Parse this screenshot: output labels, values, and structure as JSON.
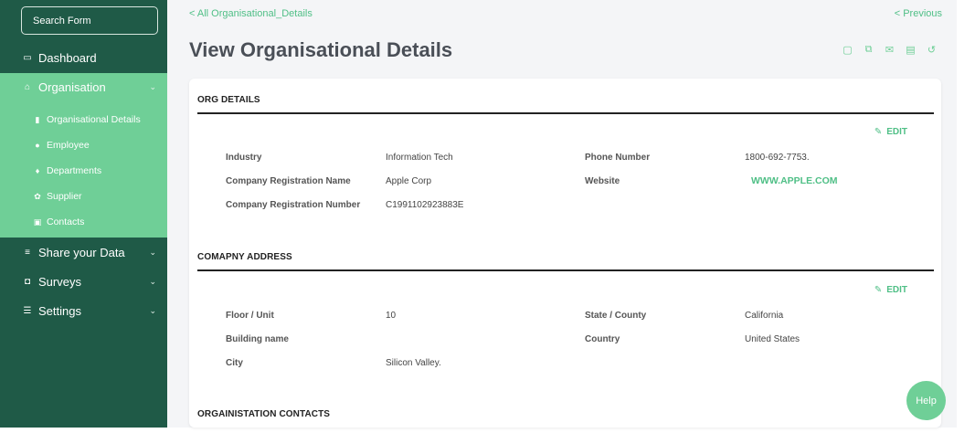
{
  "sidebar": {
    "search_label": "Search Form",
    "items": [
      {
        "label": "Dashboard",
        "icon": "dashboard-icon"
      },
      {
        "label": "Organisation",
        "icon": "bank-icon"
      },
      {
        "label": "Share your Data",
        "icon": "database-icon"
      },
      {
        "label": "Surveys",
        "icon": "survey-icon"
      },
      {
        "label": "Settings",
        "icon": "sliders-icon"
      }
    ],
    "sub_items": [
      {
        "label": "Organisational Details",
        "icon": "document-icon"
      },
      {
        "label": "Employee",
        "icon": "person-icon"
      },
      {
        "label": "Departments",
        "icon": "person-icon"
      },
      {
        "label": "Supplier",
        "icon": "supplier-icon"
      },
      {
        "label": "Contacts",
        "icon": "contacts-icon"
      }
    ]
  },
  "header": {
    "breadcrumb": "< All Organisational_Details",
    "previous": "< Previous",
    "title": "View Organisational Details"
  },
  "org_details": {
    "title": "ORG DETAILS",
    "edit": "EDIT",
    "industry_label": "Industry",
    "industry_value": "Information Tech",
    "reg_name_label": "Company Registration Name",
    "reg_name_value": "Apple Corp",
    "reg_number_label": "Company Registration Number",
    "reg_number_value": "C1991102923883E",
    "phone_label": "Phone Number",
    "phone_value": "1800-692-7753.",
    "website_label": "Website",
    "website_value": "WWW.APPLE.COM"
  },
  "address": {
    "title": "COMAPNY ADDRESS",
    "edit": "EDIT",
    "floor_label": "Floor / Unit",
    "floor_value": "10",
    "building_label": "Building name",
    "building_value": "",
    "city_label": "City",
    "city_value": "Silicon Valley.",
    "state_label": "State / County",
    "state_value": "California",
    "country_label": "Country",
    "country_value": "United States"
  },
  "contacts": {
    "title": "ORGAINISTATION CONTACTS"
  },
  "help": "Help",
  "colors": {
    "sidebar": "#1f5a47",
    "accent": "#6fcf97",
    "link": "#4fbf86"
  }
}
